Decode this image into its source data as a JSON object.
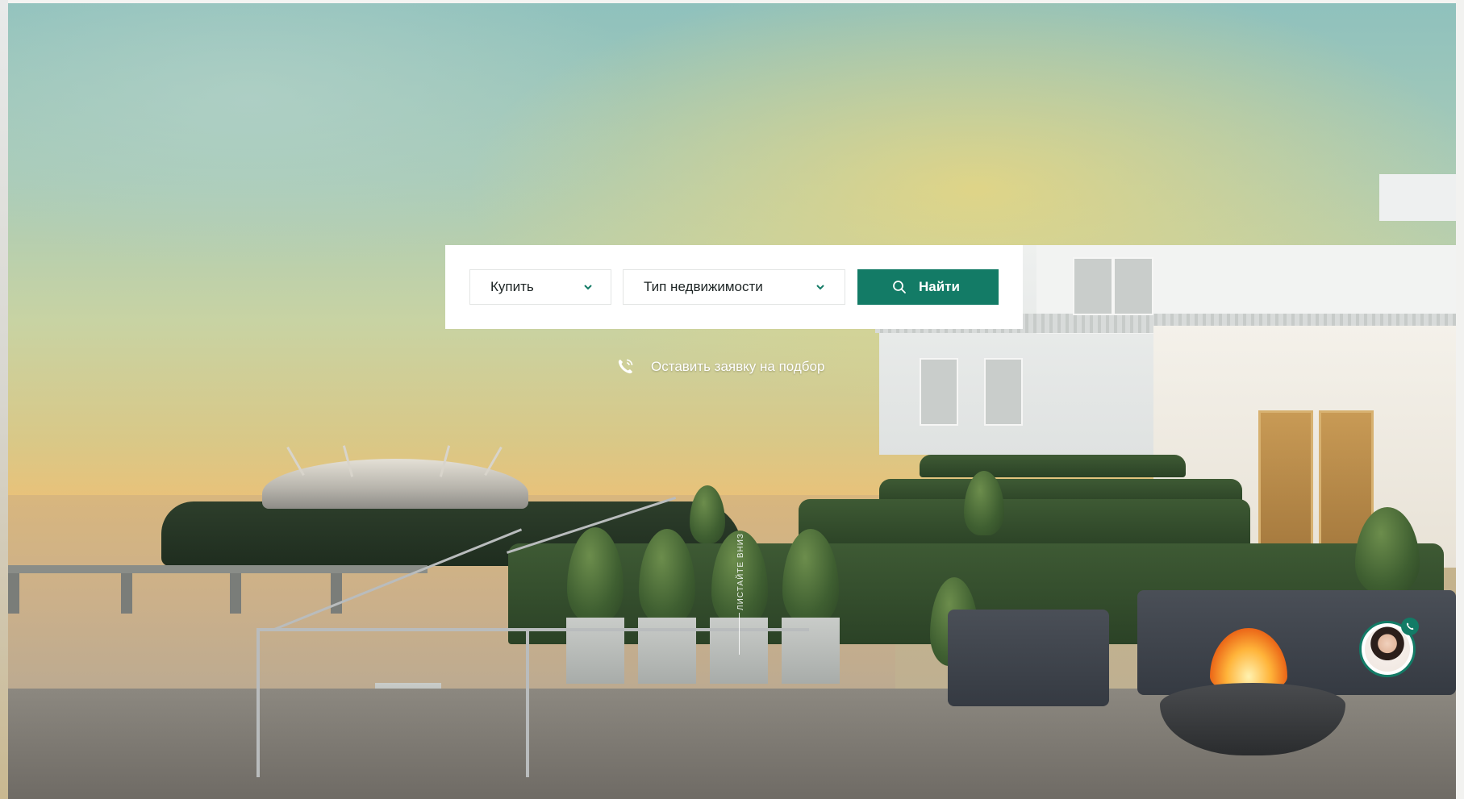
{
  "search": {
    "deal_type": {
      "selected": "Купить"
    },
    "property_type": {
      "selected": "Тип недвижимости"
    },
    "submit_label": "Найти"
  },
  "request": {
    "label": "Оставить заявку на подбор"
  },
  "scroll_hint": {
    "label": "ЛИСТАЙТЕ ВНИЗ"
  },
  "icons": {
    "search": "search-icon",
    "chevron": "chevron-down-icon",
    "phone": "phone-icon",
    "consultant_call": "phone-badge-icon"
  },
  "colors": {
    "accent": "#137b66",
    "panel_bg": "#ffffff",
    "text": "#1d2424"
  }
}
